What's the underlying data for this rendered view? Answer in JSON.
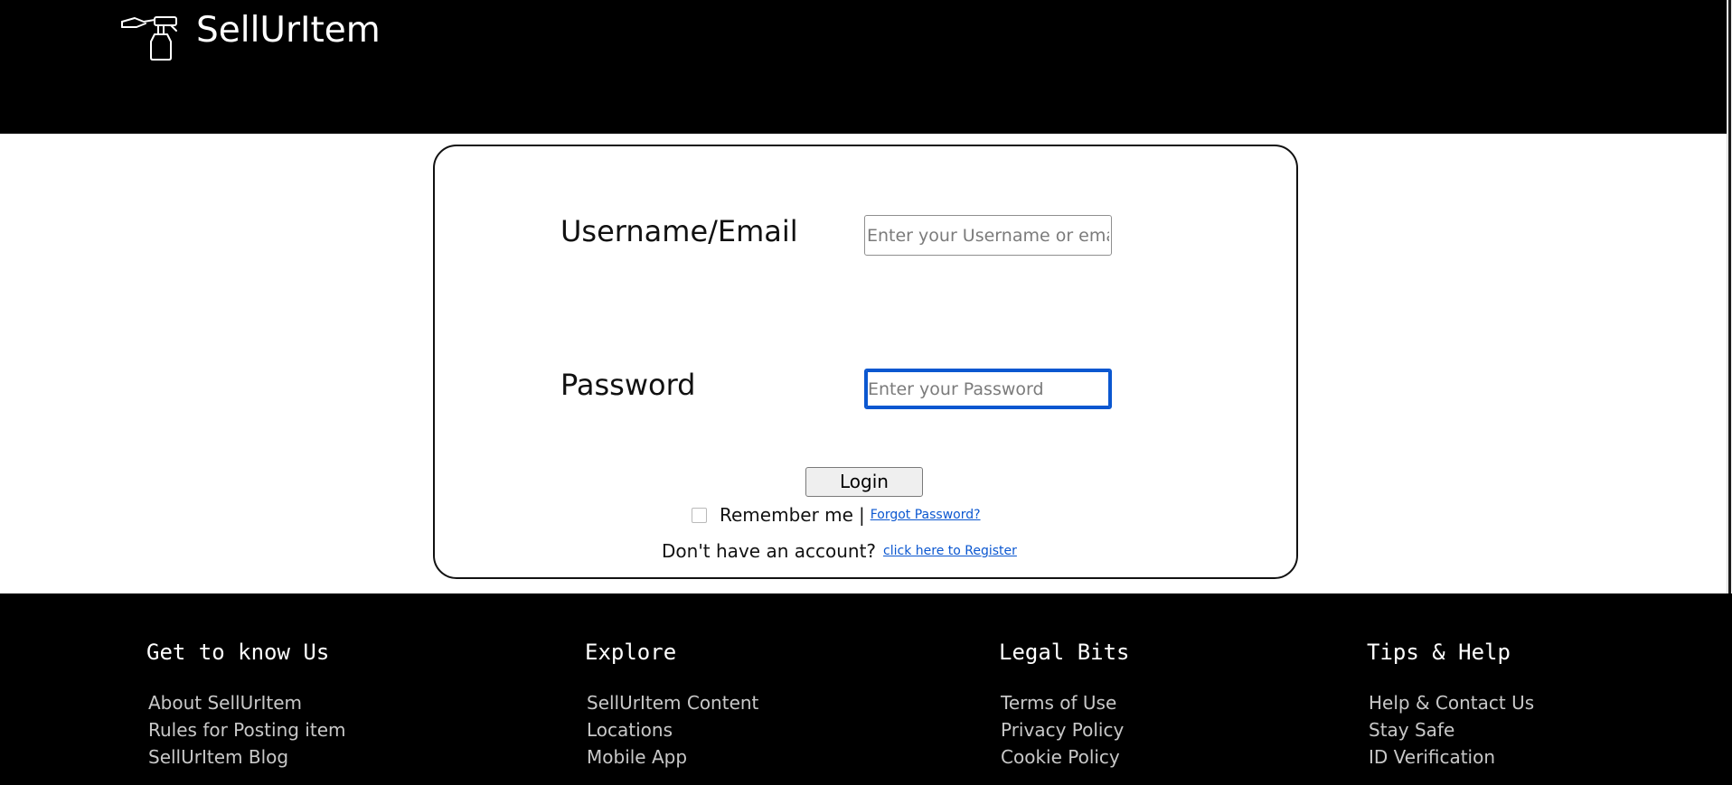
{
  "header": {
    "brand": "SellUrItem",
    "logo_icon": "hand-holding-spray-bottle-icon"
  },
  "login": {
    "username_label": "Username/Email",
    "username_placeholder": "Enter your Username or email",
    "username_value": "",
    "password_label": "Password",
    "password_placeholder": "Enter your Password",
    "password_value": "",
    "login_button": "Login",
    "remember_label": "Remember me",
    "remember_checked": false,
    "separator": "|",
    "forgot_link": "Forgot Password?",
    "no_account_text": "Don't have an account?",
    "register_link": "click here to Register"
  },
  "footer": {
    "columns": [
      {
        "heading": "Get to know Us",
        "links": [
          "About SellUrItem",
          "Rules for Posting item",
          "SellUrItem Blog"
        ]
      },
      {
        "heading": "Explore",
        "links": [
          "SellUrItem Content",
          "Locations",
          "Mobile App"
        ]
      },
      {
        "heading": "Legal Bits",
        "links": [
          "Terms of Use",
          "Privacy Policy",
          "Cookie Policy"
        ]
      },
      {
        "heading": "Tips & Help",
        "links": [
          "Help & Contact Us",
          "Stay Safe",
          "ID Verification"
        ]
      }
    ]
  },
  "colors": {
    "header_bg": "#000000",
    "footer_bg": "#000000",
    "link": "#0b57d0",
    "focus_border": "#0b57d0"
  }
}
